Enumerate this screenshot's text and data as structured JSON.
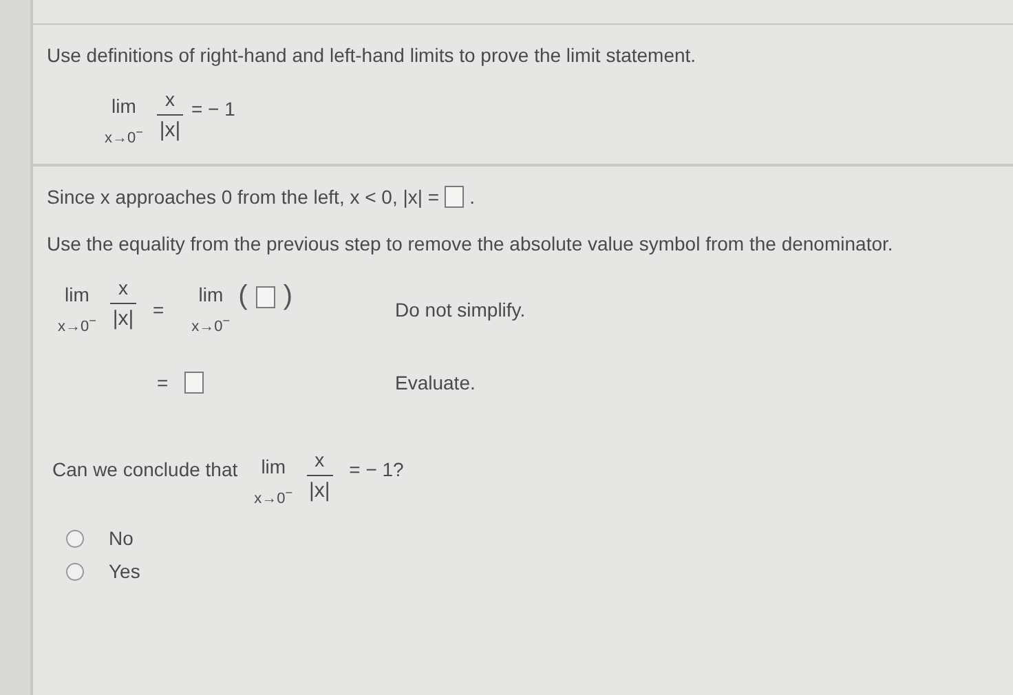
{
  "instruction": "Use definitions of right-hand and left-hand limits to prove the limit statement.",
  "statement": {
    "lim": "lim",
    "approach": "x→0$^{−}$",
    "numerator": "x",
    "denominator": "|x|",
    "rhs": "= − 1"
  },
  "step1": {
    "text": "Since x approaches 0 from the left, x < 0, |x| =",
    "after": "."
  },
  "step2_instruction": "Use the equality from the previous step to remove the absolute value symbol from the denominator.",
  "step2": {
    "left": {
      "lim": "lim",
      "approach": "x→0$^{−}$",
      "numerator": "x",
      "denominator": "|x|"
    },
    "eq": "=",
    "right_lim": "lim",
    "right_approach": "x→0$^{−}$",
    "paren_open": "(",
    "paren_close": ")",
    "hint": "Do not simplify."
  },
  "step3": {
    "eq": "=",
    "hint": "Evaluate."
  },
  "question": {
    "text": "Can we conclude that",
    "limit": {
      "lim": "lim",
      "approach": "x→0$^{−}$",
      "numerator": "x",
      "denominator": "|x|"
    },
    "rhs": "= − 1?"
  },
  "options": [
    {
      "label": "No",
      "selected": false
    },
    {
      "label": "Yes",
      "selected": false
    }
  ]
}
